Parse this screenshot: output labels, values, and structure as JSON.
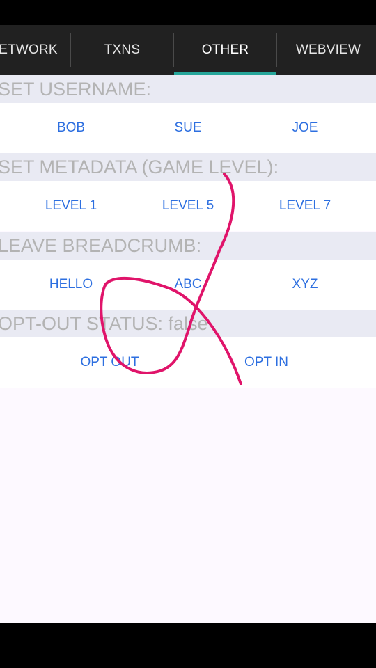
{
  "tabs": [
    {
      "label": "ETWORK",
      "active": false
    },
    {
      "label": "TXNS",
      "active": false
    },
    {
      "label": "OTHER",
      "active": true
    },
    {
      "label": "WEBVIEW",
      "active": false
    }
  ],
  "sections": {
    "username": {
      "header": "SET USERNAME:",
      "buttons": [
        "BOB",
        "SUE",
        "JOE"
      ]
    },
    "metadata": {
      "header": "SET METADATA (GAME LEVEL):",
      "buttons": [
        "LEVEL 1",
        "LEVEL 5",
        "LEVEL 7"
      ]
    },
    "breadcrumb": {
      "header": "LEAVE BREADCRUMB:",
      "buttons": [
        "HELLO",
        "ABC",
        "XYZ"
      ]
    },
    "optout": {
      "header": "OPT-OUT STATUS: false",
      "buttons": [
        "OPT OUT",
        "OPT IN"
      ]
    }
  },
  "colors": {
    "tab_indicator": "#26a69a",
    "button_text": "#2d6fe0",
    "header_bg": "#e9eaf3",
    "header_text": "#b3b3b3",
    "scribble": "#e0146a"
  }
}
